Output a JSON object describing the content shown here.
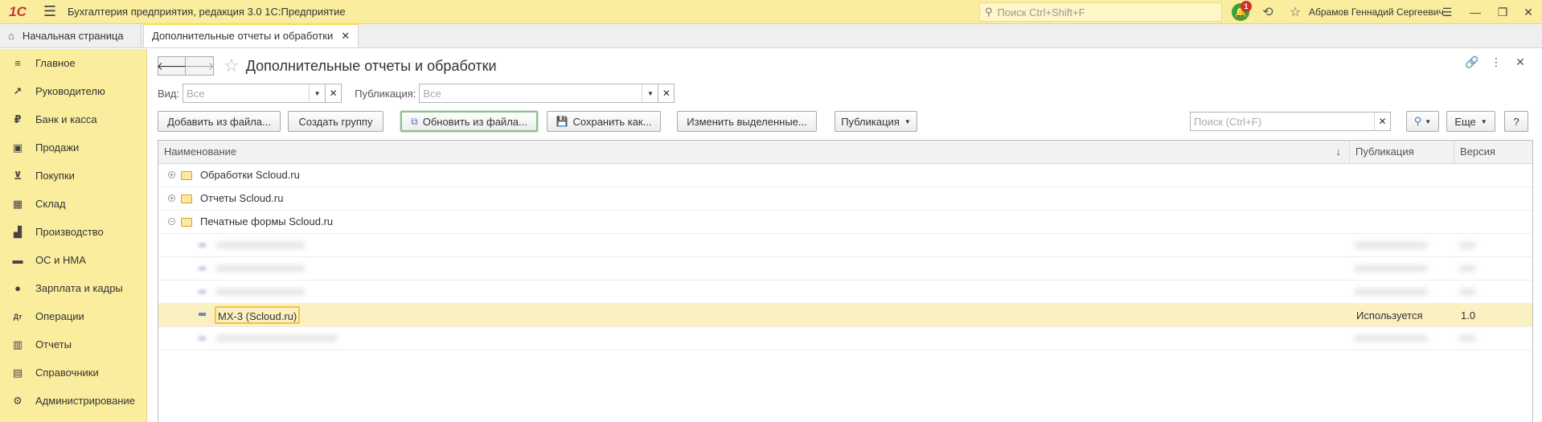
{
  "app": {
    "logo": "1С",
    "title": "Бухгалтерия предприятия, редакция 3.0 1С:Предприятие",
    "search_placeholder": "Поиск Ctrl+Shift+F",
    "notifications_count": "1",
    "user": "Абрамов Геннадий Сергеевич"
  },
  "tabs": {
    "home": "Начальная страница",
    "active": "Дополнительные отчеты и обработки"
  },
  "sidebar": {
    "items": [
      {
        "label": "Главное",
        "icon": "menu-icon"
      },
      {
        "label": "Руководителю",
        "icon": "trend-icon"
      },
      {
        "label": "Банк и касса",
        "icon": "ruble-icon"
      },
      {
        "label": "Продажи",
        "icon": "bag-icon"
      },
      {
        "label": "Покупки",
        "icon": "cart-icon"
      },
      {
        "label": "Склад",
        "icon": "warehouse-icon"
      },
      {
        "label": "Производство",
        "icon": "factory-icon"
      },
      {
        "label": "ОС и НМА",
        "icon": "truck-icon"
      },
      {
        "label": "Зарплата и кадры",
        "icon": "person-icon"
      },
      {
        "label": "Операции",
        "icon": "dt-kt-icon"
      },
      {
        "label": "Отчеты",
        "icon": "bar-chart-icon"
      },
      {
        "label": "Справочники",
        "icon": "book-icon"
      },
      {
        "label": "Администрирование",
        "icon": "gear-icon"
      }
    ]
  },
  "form": {
    "title": "Дополнительные отчеты и обработки",
    "filters": {
      "kind_label": "Вид:",
      "kind_value": "Все",
      "publication_label": "Публикация:",
      "publication_value": "Все"
    },
    "toolbar": {
      "add_from_file": "Добавить из файла...",
      "create_group": "Создать группу",
      "update_from_file": "Обновить из файла...",
      "save_as": "Сохранить как...",
      "change_selected": "Изменить выделенные...",
      "publication": "Публикация",
      "search_placeholder": "Поиск (Ctrl+F)",
      "more": "Еще",
      "help": "?"
    },
    "table": {
      "columns": [
        "Наименование",
        "Публикация",
        "Версия"
      ],
      "groups": [
        {
          "name": "Обработки Scloud.ru",
          "expanded": false
        },
        {
          "name": "Отчеты Scloud.ru",
          "expanded": false
        },
        {
          "name": "Печатные формы Scloud.ru",
          "expanded": true
        }
      ],
      "selected_item": {
        "name": "МХ-3 (Scloud.ru)",
        "publication": "Используется",
        "version": "1.0"
      }
    }
  }
}
